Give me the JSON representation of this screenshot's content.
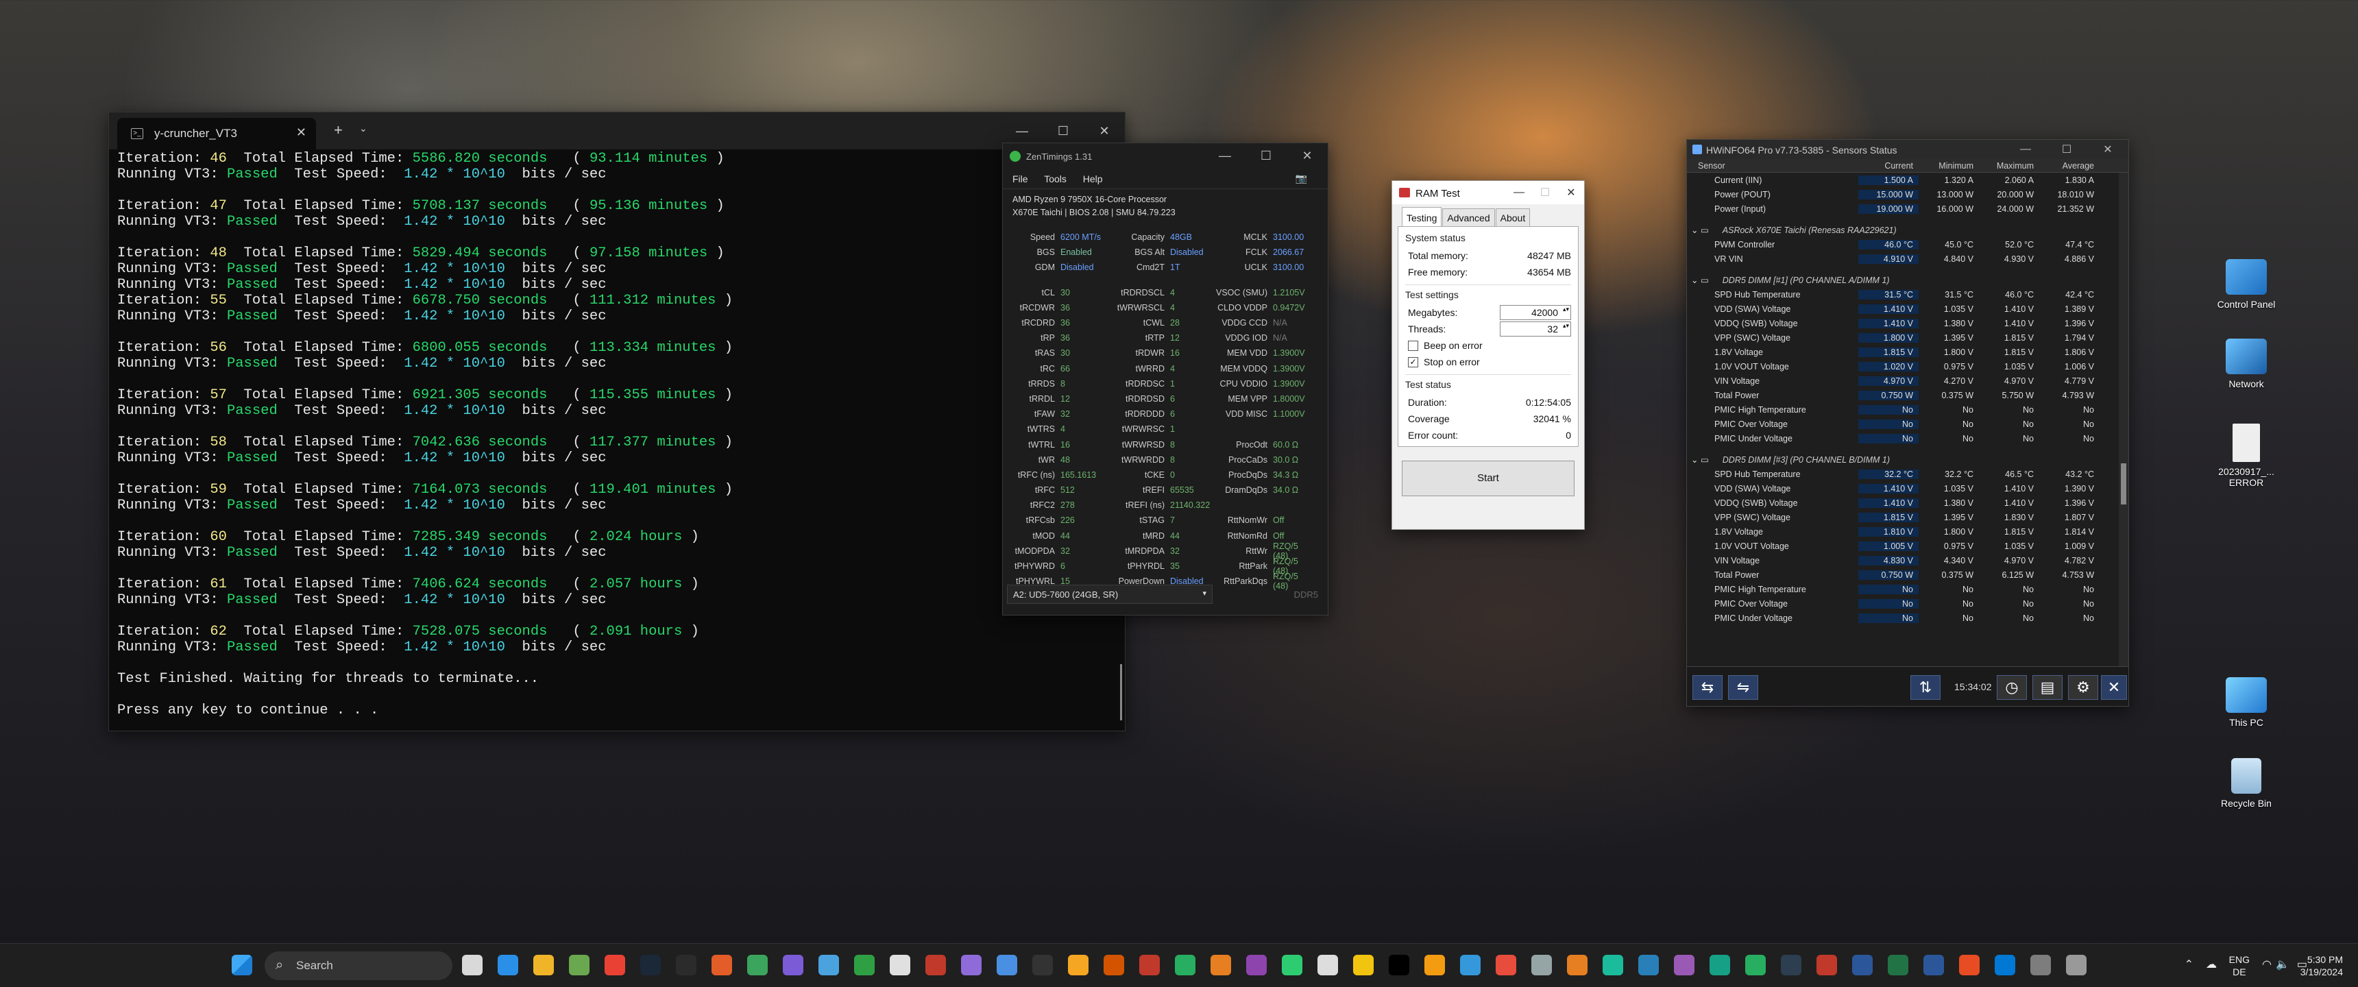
{
  "terminal": {
    "tab_title": "y-cruncher_VT3",
    "lines": [
      [
        [
          "Iteration: ",
          "w"
        ],
        [
          "46",
          "y"
        ],
        [
          "  Total Elapsed Time: ",
          "w"
        ],
        [
          "5586.820 seconds",
          "g"
        ],
        [
          "   ( ",
          "w"
        ],
        [
          "93.114 minutes",
          "g"
        ],
        [
          " )",
          "w"
        ]
      ],
      [
        [
          "Running VT3: ",
          "w"
        ],
        [
          "Passed",
          "g"
        ],
        [
          "  Test Speed:  ",
          "w"
        ],
        [
          "1.42 * 10^10",
          "c"
        ],
        [
          "  bits / sec",
          "w"
        ]
      ],
      [],
      [
        [
          "Iteration: ",
          "w"
        ],
        [
          "47",
          "y"
        ],
        [
          "  Total Elapsed Time: ",
          "w"
        ],
        [
          "5708.137 seconds",
          "g"
        ],
        [
          "   ( ",
          "w"
        ],
        [
          "95.136 minutes",
          "g"
        ],
        [
          " )",
          "w"
        ]
      ],
      [
        [
          "Running VT3: ",
          "w"
        ],
        [
          "Passed",
          "g"
        ],
        [
          "  Test Speed:  ",
          "w"
        ],
        [
          "1.42 * 10^10",
          "c"
        ],
        [
          "  bits / sec",
          "w"
        ]
      ],
      [],
      [
        [
          "Iteration: ",
          "w"
        ],
        [
          "48",
          "y"
        ],
        [
          "  Total Elapsed Time: ",
          "w"
        ],
        [
          "5829.494 seconds",
          "g"
        ],
        [
          "   ( ",
          "w"
        ],
        [
          "97.158 minutes",
          "g"
        ],
        [
          " )",
          "w"
        ]
      ],
      [
        [
          "Running VT3: ",
          "w"
        ],
        [
          "Passed",
          "g"
        ],
        [
          "  Test Speed:  ",
          "w"
        ],
        [
          "1.42 * 10^10",
          "c"
        ],
        [
          "  bits / sec",
          "w"
        ]
      ],
      [
        [
          "Running VT3: ",
          "w"
        ],
        [
          "Passed",
          "g"
        ],
        [
          "  Test Speed:  ",
          "w"
        ],
        [
          "1.42 * 10^10",
          "c"
        ],
        [
          "  bits / sec",
          "w"
        ]
      ],
      [
        [
          "Iteration: ",
          "w"
        ],
        [
          "55",
          "y"
        ],
        [
          "  Total Elapsed Time: ",
          "w"
        ],
        [
          "6678.750 seconds",
          "g"
        ],
        [
          "   ( ",
          "w"
        ],
        [
          "111.312 minutes",
          "g"
        ],
        [
          " )",
          "w"
        ]
      ],
      [
        [
          "Running VT3: ",
          "w"
        ],
        [
          "Passed",
          "g"
        ],
        [
          "  Test Speed:  ",
          "w"
        ],
        [
          "1.42 * 10^10",
          "c"
        ],
        [
          "  bits / sec",
          "w"
        ]
      ],
      [],
      [
        [
          "Iteration: ",
          "w"
        ],
        [
          "56",
          "y"
        ],
        [
          "  Total Elapsed Time: ",
          "w"
        ],
        [
          "6800.055 seconds",
          "g"
        ],
        [
          "   ( ",
          "w"
        ],
        [
          "113.334 minutes",
          "g"
        ],
        [
          " )",
          "w"
        ]
      ],
      [
        [
          "Running VT3: ",
          "w"
        ],
        [
          "Passed",
          "g"
        ],
        [
          "  Test Speed:  ",
          "w"
        ],
        [
          "1.42 * 10^10",
          "c"
        ],
        [
          "  bits / sec",
          "w"
        ]
      ],
      [],
      [
        [
          "Iteration: ",
          "w"
        ],
        [
          "57",
          "y"
        ],
        [
          "  Total Elapsed Time: ",
          "w"
        ],
        [
          "6921.305 seconds",
          "g"
        ],
        [
          "   ( ",
          "w"
        ],
        [
          "115.355 minutes",
          "g"
        ],
        [
          " )",
          "w"
        ]
      ],
      [
        [
          "Running VT3: ",
          "w"
        ],
        [
          "Passed",
          "g"
        ],
        [
          "  Test Speed:  ",
          "w"
        ],
        [
          "1.42 * 10^10",
          "c"
        ],
        [
          "  bits / sec",
          "w"
        ]
      ],
      [],
      [
        [
          "Iteration: ",
          "w"
        ],
        [
          "58",
          "y"
        ],
        [
          "  Total Elapsed Time: ",
          "w"
        ],
        [
          "7042.636 seconds",
          "g"
        ],
        [
          "   ( ",
          "w"
        ],
        [
          "117.377 minutes",
          "g"
        ],
        [
          " )",
          "w"
        ]
      ],
      [
        [
          "Running VT3: ",
          "w"
        ],
        [
          "Passed",
          "g"
        ],
        [
          "  Test Speed:  ",
          "w"
        ],
        [
          "1.42 * 10^10",
          "c"
        ],
        [
          "  bits / sec",
          "w"
        ]
      ],
      [],
      [
        [
          "Iteration: ",
          "w"
        ],
        [
          "59",
          "y"
        ],
        [
          "  Total Elapsed Time: ",
          "w"
        ],
        [
          "7164.073 seconds",
          "g"
        ],
        [
          "   ( ",
          "w"
        ],
        [
          "119.401 minutes",
          "g"
        ],
        [
          " )",
          "w"
        ]
      ],
      [
        [
          "Running VT3: ",
          "w"
        ],
        [
          "Passed",
          "g"
        ],
        [
          "  Test Speed:  ",
          "w"
        ],
        [
          "1.42 * 10^10",
          "c"
        ],
        [
          "  bits / sec",
          "w"
        ]
      ],
      [],
      [
        [
          "Iteration: ",
          "w"
        ],
        [
          "60",
          "y"
        ],
        [
          "  Total Elapsed Time: ",
          "w"
        ],
        [
          "7285.349 seconds",
          "g"
        ],
        [
          "   ( ",
          "w"
        ],
        [
          "2.024 hours",
          "g"
        ],
        [
          " )",
          "w"
        ]
      ],
      [
        [
          "Running VT3: ",
          "w"
        ],
        [
          "Passed",
          "g"
        ],
        [
          "  Test Speed:  ",
          "w"
        ],
        [
          "1.42 * 10^10",
          "c"
        ],
        [
          "  bits / sec",
          "w"
        ]
      ],
      [],
      [
        [
          "Iteration: ",
          "w"
        ],
        [
          "61",
          "y"
        ],
        [
          "  Total Elapsed Time: ",
          "w"
        ],
        [
          "7406.624 seconds",
          "g"
        ],
        [
          "   ( ",
          "w"
        ],
        [
          "2.057 hours",
          "g"
        ],
        [
          " )",
          "w"
        ]
      ],
      [
        [
          "Running VT3: ",
          "w"
        ],
        [
          "Passed",
          "g"
        ],
        [
          "  Test Speed:  ",
          "w"
        ],
        [
          "1.42 * 10^10",
          "c"
        ],
        [
          "  bits / sec",
          "w"
        ]
      ],
      [],
      [
        [
          "Iteration: ",
          "w"
        ],
        [
          "62",
          "y"
        ],
        [
          "  Total Elapsed Time: ",
          "w"
        ],
        [
          "7528.075 seconds",
          "g"
        ],
        [
          "   ( ",
          "w"
        ],
        [
          "2.091 hours",
          "g"
        ],
        [
          " )",
          "w"
        ]
      ],
      [
        [
          "Running VT3: ",
          "w"
        ],
        [
          "Passed",
          "g"
        ],
        [
          "  Test Speed:  ",
          "w"
        ],
        [
          "1.42 * 10^10",
          "c"
        ],
        [
          "  bits / sec",
          "w"
        ]
      ],
      [],
      [
        [
          "Test Finished. Waiting for threads to terminate...",
          "w"
        ]
      ],
      [],
      [
        [
          "Press any key to continue . . .",
          "w"
        ]
      ]
    ]
  },
  "zentimings": {
    "title": "ZenTimings 1.31",
    "menu": [
      "File",
      "Tools",
      "Help"
    ],
    "cpu": "AMD Ryzen 9 7950X 16-Core Processor",
    "board": "X670E Taichi | BIOS 2.08 | SMU 84.79.223",
    "rows": [
      [
        [
          "Speed",
          "6200 MT/s",
          "a"
        ],
        [
          "Capacity",
          "48GB",
          "a"
        ],
        [
          "MCLK",
          "3100.00",
          "a"
        ]
      ],
      [
        [
          "BGS",
          "Enabled",
          "g2"
        ],
        [
          "BGS Alt",
          "Disabled",
          "a"
        ],
        [
          "FCLK",
          "2066.67",
          "a"
        ]
      ],
      [
        [
          "GDM",
          "Disabled",
          "a"
        ],
        [
          "Cmd2T",
          "1T",
          "a"
        ],
        [
          "UCLK",
          "3100.00",
          "a"
        ]
      ],
      [],
      [
        [
          "tCL",
          "30",
          ""
        ],
        [
          "tRDRDSCL",
          "4",
          ""
        ],
        [
          "VSOC (SMU)",
          "1.2105V",
          ""
        ]
      ],
      [
        [
          "tRCDWR",
          "36",
          ""
        ],
        [
          "tWRWRSCL",
          "4",
          ""
        ],
        [
          "CLDO VDDP",
          "0.9472V",
          ""
        ]
      ],
      [
        [
          "tRCDRD",
          "36",
          ""
        ],
        [
          "tCWL",
          "28",
          ""
        ],
        [
          "VDDG CCD",
          "N/A",
          "g"
        ]
      ],
      [
        [
          "tRP",
          "36",
          ""
        ],
        [
          "tRTP",
          "12",
          ""
        ],
        [
          "VDDG IOD",
          "N/A",
          "g"
        ]
      ],
      [
        [
          "tRAS",
          "30",
          ""
        ],
        [
          "tRDWR",
          "16",
          ""
        ],
        [
          "MEM VDD",
          "1.3900V",
          ""
        ]
      ],
      [
        [
          "tRC",
          "66",
          ""
        ],
        [
          "tWRRD",
          "4",
          ""
        ],
        [
          "MEM VDDQ",
          "1.3900V",
          ""
        ]
      ],
      [
        [
          "tRRDS",
          "8",
          ""
        ],
        [
          "tRDRDSC",
          "1",
          ""
        ],
        [
          "CPU VDDIO",
          "1.3900V",
          ""
        ]
      ],
      [
        [
          "tRRDL",
          "12",
          ""
        ],
        [
          "tRDRDSD",
          "6",
          ""
        ],
        [
          "MEM VPP",
          "1.8000V",
          ""
        ]
      ],
      [
        [
          "tFAW",
          "32",
          ""
        ],
        [
          "tRDRDDD",
          "6",
          ""
        ],
        [
          "VDD MISC",
          "1.1000V",
          ""
        ]
      ],
      [
        [
          "tWTRS",
          "4",
          ""
        ],
        [
          "tWRWRSC",
          "1",
          ""
        ],
        [
          "",
          ""
        ]
      ],
      [
        [
          "tWTRL",
          "16",
          ""
        ],
        [
          "tWRWRSD",
          "8",
          ""
        ],
        [
          "ProcOdt",
          "60.0 Ω",
          ""
        ]
      ],
      [
        [
          "tWR",
          "48",
          ""
        ],
        [
          "tWRWRDD",
          "8",
          ""
        ],
        [
          "ProcCaDs",
          "30.0 Ω",
          ""
        ]
      ],
      [
        [
          "tRFC (ns)",
          "165.1613",
          ""
        ],
        [
          "tCKE",
          "0",
          ""
        ],
        [
          "ProcDqDs",
          "34.3 Ω",
          ""
        ]
      ],
      [
        [
          "tRFC",
          "512",
          ""
        ],
        [
          "tREFI",
          "65535",
          ""
        ],
        [
          "DramDqDs",
          "34.0 Ω",
          ""
        ]
      ],
      [
        [
          "tRFC2",
          "278",
          ""
        ],
        [
          "tREFI (ns)",
          "21140.322",
          ""
        ],
        [
          "",
          ""
        ]
      ],
      [
        [
          "tRFCsb",
          "226",
          ""
        ],
        [
          "tSTAG",
          "7",
          ""
        ],
        [
          "RttNomWr",
          "Off",
          ""
        ]
      ],
      [
        [
          "tMOD",
          "44",
          ""
        ],
        [
          "tMRD",
          "44",
          ""
        ],
        [
          "RttNomRd",
          "Off",
          ""
        ]
      ],
      [
        [
          "tMODPDA",
          "32",
          ""
        ],
        [
          "tMRDPDA",
          "32",
          ""
        ],
        [
          "RttWr",
          "RZQ/5 (48)",
          ""
        ]
      ],
      [
        [
          "tPHYWRD",
          "6",
          ""
        ],
        [
          "tPHYRDL",
          "35",
          ""
        ],
        [
          "RttPark",
          "RZQ/5 (48)",
          ""
        ]
      ],
      [
        [
          "tPHYWRL",
          "15",
          ""
        ],
        [
          "PowerDown",
          "Disabled",
          "a"
        ],
        [
          "RttParkDqs",
          "RZQ/5 (48)",
          ""
        ]
      ]
    ],
    "module": "A2: UD5-7600 (24GB, SR)",
    "ddr": "DDR5"
  },
  "ramtest": {
    "title": "RAM Test",
    "tabs": [
      "Testing",
      "Advanced",
      "About"
    ],
    "system_status": "System status",
    "total_label": "Total memory:",
    "total": "48247 MB",
    "free_label": "Free memory:",
    "free": "43654 MB",
    "settings": "Test settings",
    "mb_label": "Megabytes:",
    "mb": "42000",
    "threads_label": "Threads:",
    "threads": "32",
    "beep": "Beep on error",
    "stop": "Stop on error",
    "status": "Test status",
    "dur_label": "Duration:",
    "dur": "0:12:54:05",
    "cov_label": "Coverage",
    "cov": "32041 %",
    "err_label": "Error count:",
    "err": "0",
    "start": "Start"
  },
  "hwinfo": {
    "title": "HWiNFO64 Pro v7.73-5385 - Sensors Status",
    "cols": [
      "Sensor",
      "Current",
      "Minimum",
      "Maximum",
      "Average"
    ],
    "rows": [
      [
        "s",
        "Current (IIN)",
        "1.500 A",
        "1.320 A",
        "2.060 A",
        "1.830 A"
      ],
      [
        "s",
        "Power (POUT)",
        "15.000 W",
        "13.000 W",
        "20.000 W",
        "18.010 W"
      ],
      [
        "s",
        "Power (Input)",
        "19.000 W",
        "16.000 W",
        "24.000 W",
        "21.352 W"
      ],
      [
        "g",
        "ASRock X670E Taichi (Renesas RAA229621)"
      ],
      [
        "s",
        "PWM Controller",
        "46.0 °C",
        "45.0 °C",
        "52.0 °C",
        "47.4 °C"
      ],
      [
        "s",
        "VR VIN",
        "4.910 V",
        "4.840 V",
        "4.930 V",
        "4.886 V"
      ],
      [
        "g",
        "DDR5 DIMM [#1] (P0 CHANNEL A/DIMM 1)"
      ],
      [
        "s",
        "SPD Hub Temperature",
        "31.5 °C",
        "31.5 °C",
        "46.0 °C",
        "42.4 °C"
      ],
      [
        "s",
        "VDD (SWA) Voltage",
        "1.410 V",
        "1.035 V",
        "1.410 V",
        "1.389 V"
      ],
      [
        "s",
        "VDDQ (SWB) Voltage",
        "1.410 V",
        "1.380 V",
        "1.410 V",
        "1.396 V"
      ],
      [
        "s",
        "VPP (SWC) Voltage",
        "1.800 V",
        "1.395 V",
        "1.815 V",
        "1.794 V"
      ],
      [
        "s",
        "1.8V Voltage",
        "1.815 V",
        "1.800 V",
        "1.815 V",
        "1.806 V"
      ],
      [
        "s",
        "1.0V VOUT Voltage",
        "1.020 V",
        "0.975 V",
        "1.035 V",
        "1.006 V"
      ],
      [
        "s",
        "VIN Voltage",
        "4.970 V",
        "4.270 V",
        "4.970 V",
        "4.779 V"
      ],
      [
        "s",
        "Total Power",
        "0.750 W",
        "0.375 W",
        "5.750 W",
        "4.793 W"
      ],
      [
        "s",
        "PMIC High Temperature",
        "No",
        "No",
        "No",
        "No"
      ],
      [
        "s",
        "PMIC Over Voltage",
        "No",
        "No",
        "No",
        "No"
      ],
      [
        "s",
        "PMIC Under Voltage",
        "No",
        "No",
        "No",
        "No"
      ],
      [
        "g",
        "DDR5 DIMM [#3] (P0 CHANNEL B/DIMM 1)"
      ],
      [
        "s",
        "SPD Hub Temperature",
        "32.2 °C",
        "32.2 °C",
        "46.5 °C",
        "43.2 °C"
      ],
      [
        "s",
        "VDD (SWA) Voltage",
        "1.410 V",
        "1.035 V",
        "1.410 V",
        "1.390 V"
      ],
      [
        "s",
        "VDDQ (SWB) Voltage",
        "1.410 V",
        "1.380 V",
        "1.410 V",
        "1.396 V"
      ],
      [
        "s",
        "VPP (SWC) Voltage",
        "1.815 V",
        "1.395 V",
        "1.830 V",
        "1.807 V"
      ],
      [
        "s",
        "1.8V Voltage",
        "1.810 V",
        "1.800 V",
        "1.815 V",
        "1.814 V"
      ],
      [
        "s",
        "1.0V VOUT Voltage",
        "1.005 V",
        "0.975 V",
        "1.035 V",
        "1.009 V"
      ],
      [
        "s",
        "VIN Voltage",
        "4.830 V",
        "4.340 V",
        "4.970 V",
        "4.782 V"
      ],
      [
        "s",
        "Total Power",
        "0.750 W",
        "0.375 W",
        "6.125 W",
        "4.753 W"
      ],
      [
        "s",
        "PMIC High Temperature",
        "No",
        "No",
        "No",
        "No"
      ],
      [
        "s",
        "PMIC Over Voltage",
        "No",
        "No",
        "No",
        "No"
      ],
      [
        "s",
        "PMIC Under Voltage",
        "No",
        "No",
        "No",
        "No"
      ]
    ],
    "timer": "15:34:02"
  },
  "desktop": {
    "icons": [
      "Control Panel",
      "Network",
      "20230917_... ERROR",
      "This PC",
      "Recycle Bin"
    ]
  },
  "taskbar": {
    "search": "Search",
    "lang1": "ENG",
    "lang2": "DE",
    "time": "5:30 PM",
    "date": "3/19/2024"
  }
}
